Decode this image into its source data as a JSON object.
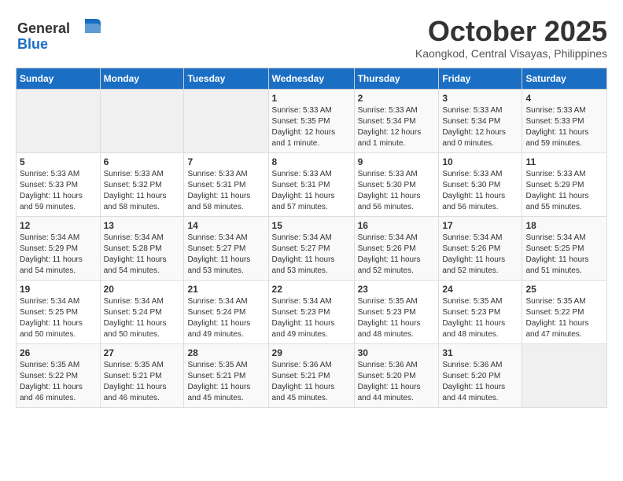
{
  "logo": {
    "general": "General",
    "blue": "Blue"
  },
  "title": "October 2025",
  "location": "Kaongkod, Central Visayas, Philippines",
  "weekdays": [
    "Sunday",
    "Monday",
    "Tuesday",
    "Wednesday",
    "Thursday",
    "Friday",
    "Saturday"
  ],
  "weeks": [
    [
      {
        "day": "",
        "info": ""
      },
      {
        "day": "",
        "info": ""
      },
      {
        "day": "",
        "info": ""
      },
      {
        "day": "1",
        "info": "Sunrise: 5:33 AM\nSunset: 5:35 PM\nDaylight: 12 hours\nand 1 minute."
      },
      {
        "day": "2",
        "info": "Sunrise: 5:33 AM\nSunset: 5:34 PM\nDaylight: 12 hours\nand 1 minute."
      },
      {
        "day": "3",
        "info": "Sunrise: 5:33 AM\nSunset: 5:34 PM\nDaylight: 12 hours\nand 0 minutes."
      },
      {
        "day": "4",
        "info": "Sunrise: 5:33 AM\nSunset: 5:33 PM\nDaylight: 11 hours\nand 59 minutes."
      }
    ],
    [
      {
        "day": "5",
        "info": "Sunrise: 5:33 AM\nSunset: 5:33 PM\nDaylight: 11 hours\nand 59 minutes."
      },
      {
        "day": "6",
        "info": "Sunrise: 5:33 AM\nSunset: 5:32 PM\nDaylight: 11 hours\nand 58 minutes."
      },
      {
        "day": "7",
        "info": "Sunrise: 5:33 AM\nSunset: 5:31 PM\nDaylight: 11 hours\nand 58 minutes."
      },
      {
        "day": "8",
        "info": "Sunrise: 5:33 AM\nSunset: 5:31 PM\nDaylight: 11 hours\nand 57 minutes."
      },
      {
        "day": "9",
        "info": "Sunrise: 5:33 AM\nSunset: 5:30 PM\nDaylight: 11 hours\nand 56 minutes."
      },
      {
        "day": "10",
        "info": "Sunrise: 5:33 AM\nSunset: 5:30 PM\nDaylight: 11 hours\nand 56 minutes."
      },
      {
        "day": "11",
        "info": "Sunrise: 5:33 AM\nSunset: 5:29 PM\nDaylight: 11 hours\nand 55 minutes."
      }
    ],
    [
      {
        "day": "12",
        "info": "Sunrise: 5:34 AM\nSunset: 5:29 PM\nDaylight: 11 hours\nand 54 minutes."
      },
      {
        "day": "13",
        "info": "Sunrise: 5:34 AM\nSunset: 5:28 PM\nDaylight: 11 hours\nand 54 minutes."
      },
      {
        "day": "14",
        "info": "Sunrise: 5:34 AM\nSunset: 5:27 PM\nDaylight: 11 hours\nand 53 minutes."
      },
      {
        "day": "15",
        "info": "Sunrise: 5:34 AM\nSunset: 5:27 PM\nDaylight: 11 hours\nand 53 minutes."
      },
      {
        "day": "16",
        "info": "Sunrise: 5:34 AM\nSunset: 5:26 PM\nDaylight: 11 hours\nand 52 minutes."
      },
      {
        "day": "17",
        "info": "Sunrise: 5:34 AM\nSunset: 5:26 PM\nDaylight: 11 hours\nand 52 minutes."
      },
      {
        "day": "18",
        "info": "Sunrise: 5:34 AM\nSunset: 5:25 PM\nDaylight: 11 hours\nand 51 minutes."
      }
    ],
    [
      {
        "day": "19",
        "info": "Sunrise: 5:34 AM\nSunset: 5:25 PM\nDaylight: 11 hours\nand 50 minutes."
      },
      {
        "day": "20",
        "info": "Sunrise: 5:34 AM\nSunset: 5:24 PM\nDaylight: 11 hours\nand 50 minutes."
      },
      {
        "day": "21",
        "info": "Sunrise: 5:34 AM\nSunset: 5:24 PM\nDaylight: 11 hours\nand 49 minutes."
      },
      {
        "day": "22",
        "info": "Sunrise: 5:34 AM\nSunset: 5:23 PM\nDaylight: 11 hours\nand 49 minutes."
      },
      {
        "day": "23",
        "info": "Sunrise: 5:35 AM\nSunset: 5:23 PM\nDaylight: 11 hours\nand 48 minutes."
      },
      {
        "day": "24",
        "info": "Sunrise: 5:35 AM\nSunset: 5:23 PM\nDaylight: 11 hours\nand 48 minutes."
      },
      {
        "day": "25",
        "info": "Sunrise: 5:35 AM\nSunset: 5:22 PM\nDaylight: 11 hours\nand 47 minutes."
      }
    ],
    [
      {
        "day": "26",
        "info": "Sunrise: 5:35 AM\nSunset: 5:22 PM\nDaylight: 11 hours\nand 46 minutes."
      },
      {
        "day": "27",
        "info": "Sunrise: 5:35 AM\nSunset: 5:21 PM\nDaylight: 11 hours\nand 46 minutes."
      },
      {
        "day": "28",
        "info": "Sunrise: 5:35 AM\nSunset: 5:21 PM\nDaylight: 11 hours\nand 45 minutes."
      },
      {
        "day": "29",
        "info": "Sunrise: 5:36 AM\nSunset: 5:21 PM\nDaylight: 11 hours\nand 45 minutes."
      },
      {
        "day": "30",
        "info": "Sunrise: 5:36 AM\nSunset: 5:20 PM\nDaylight: 11 hours\nand 44 minutes."
      },
      {
        "day": "31",
        "info": "Sunrise: 5:36 AM\nSunset: 5:20 PM\nDaylight: 11 hours\nand 44 minutes."
      },
      {
        "day": "",
        "info": ""
      }
    ]
  ]
}
